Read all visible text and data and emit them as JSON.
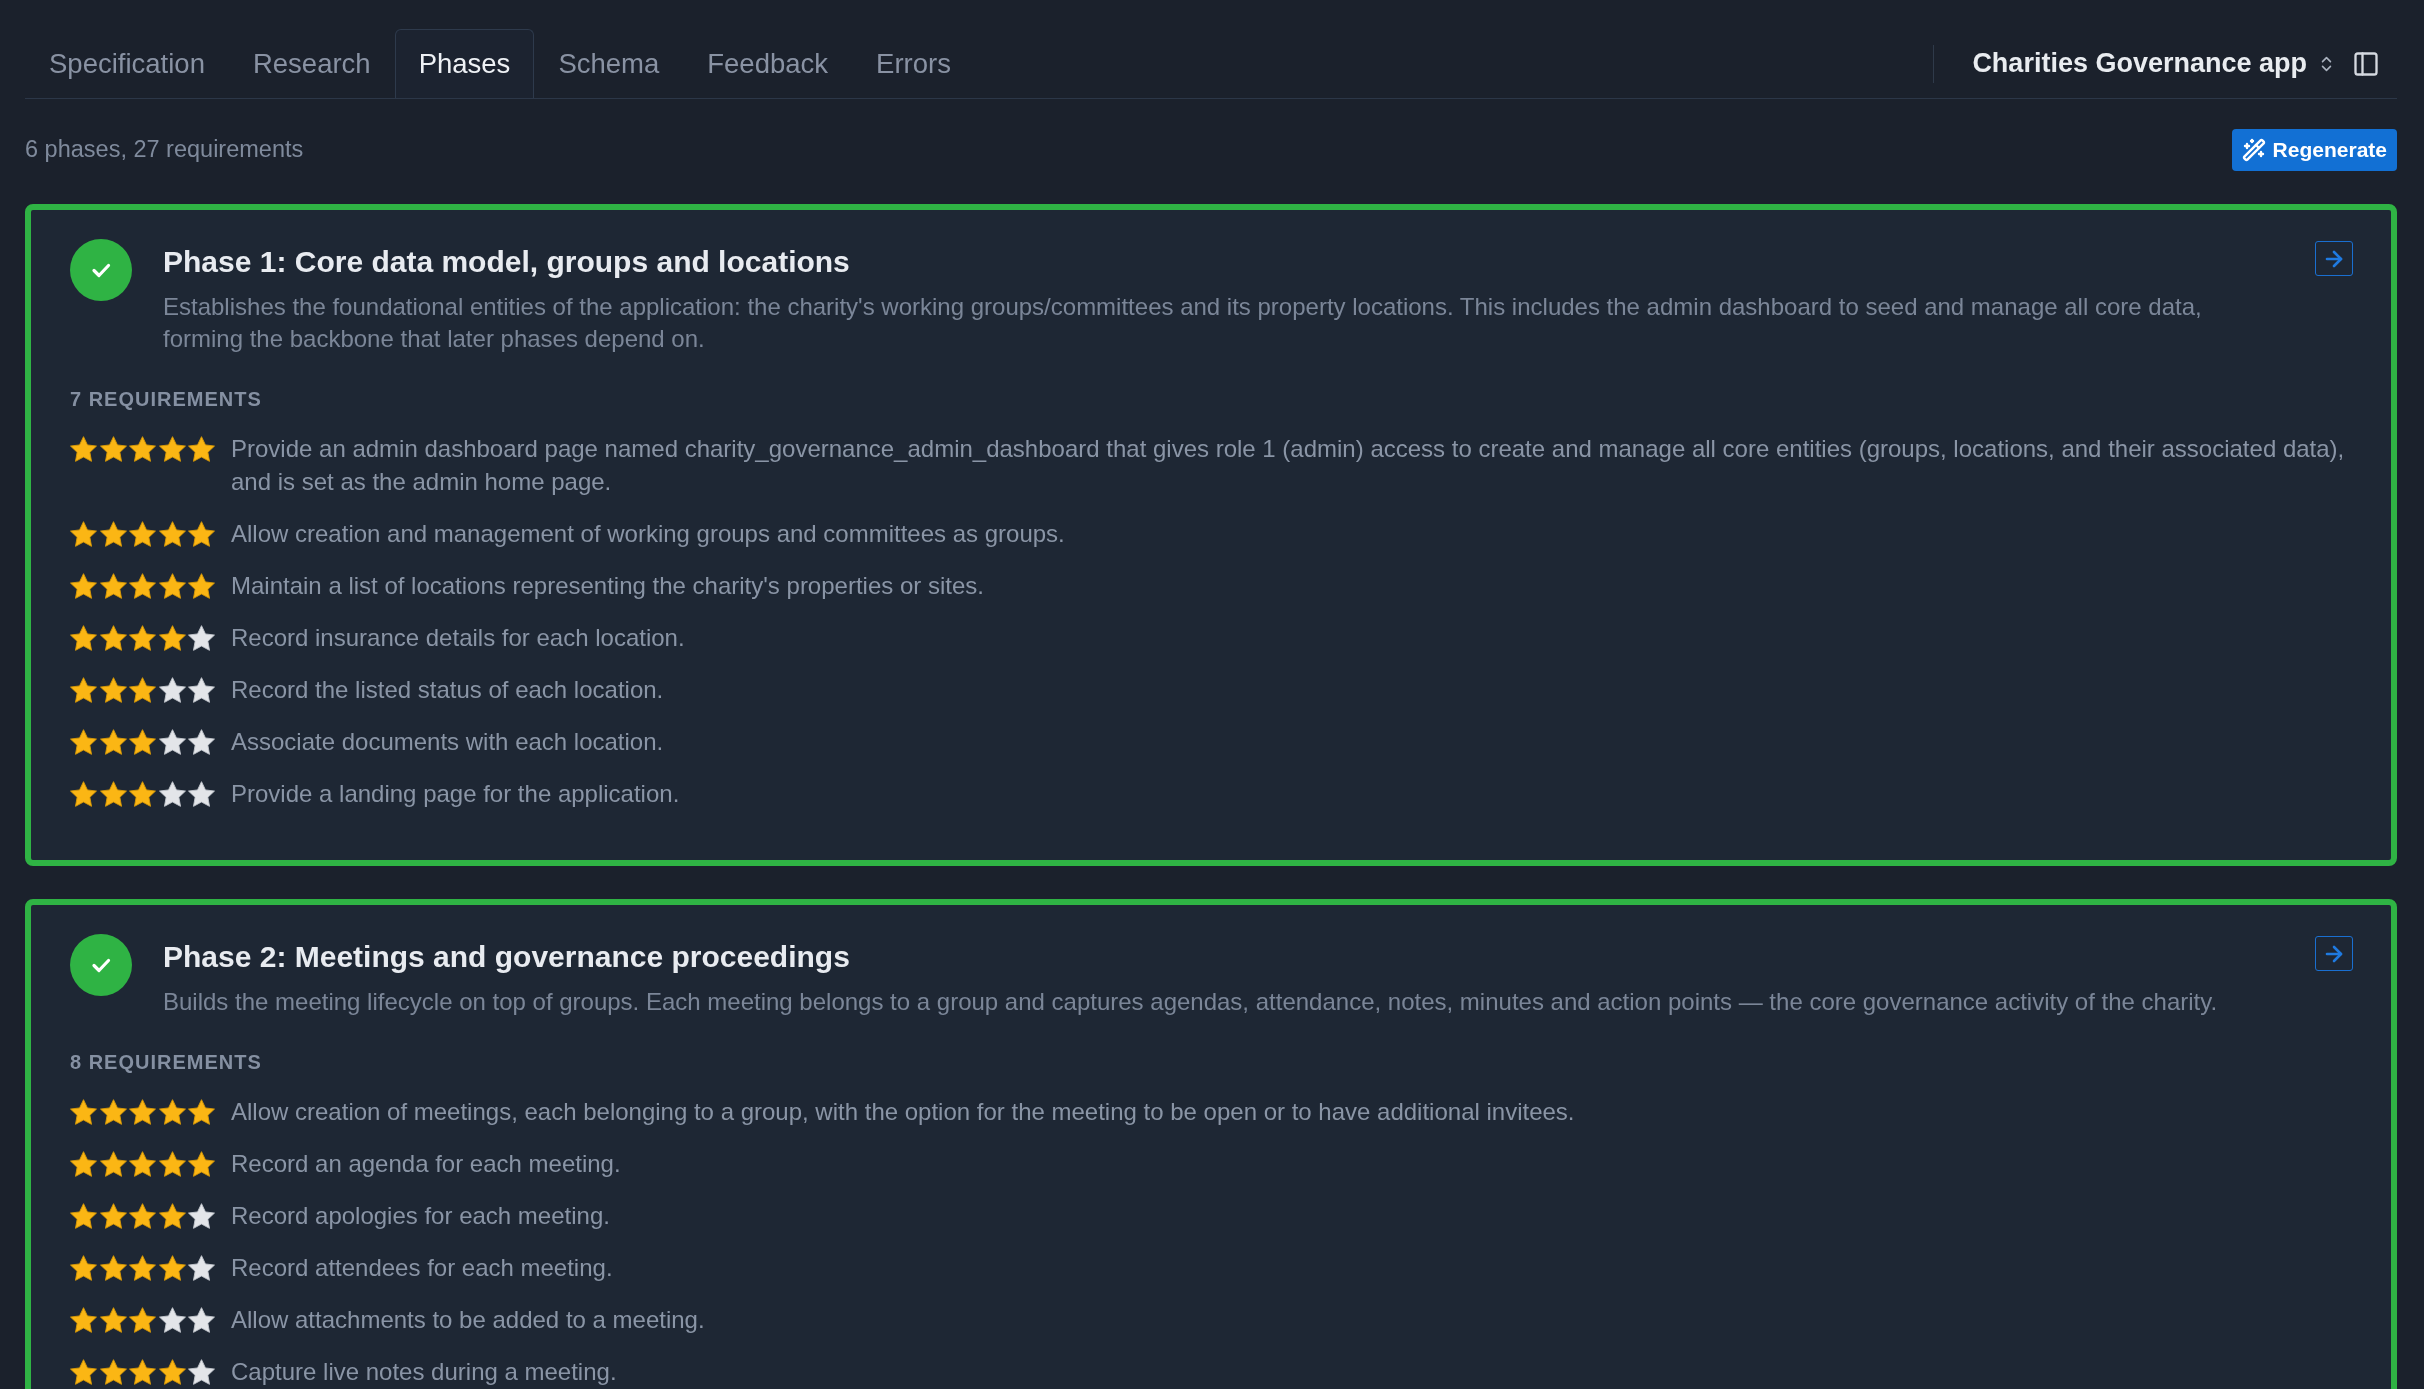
{
  "tabs": [
    {
      "label": "Specification",
      "selected": false
    },
    {
      "label": "Research",
      "selected": false
    },
    {
      "label": "Phases",
      "selected": true
    },
    {
      "label": "Schema",
      "selected": false
    },
    {
      "label": "Feedback",
      "selected": false
    },
    {
      "label": "Errors",
      "selected": false
    }
  ],
  "project_selector": {
    "label": "Charities Governance app"
  },
  "summary": "6 phases, 27 requirements",
  "regenerate_button": {
    "label": "Regenerate"
  },
  "phases": [
    {
      "title": "Phase 1: Core data model, groups and locations",
      "done": true,
      "description": "Establishes the foundational entities of the application: the charity's working groups/committees and its property locations. This includes the admin dashboard to seed and manage all core data, forming the backbone that later phases depend on.",
      "requirements_heading": "7 REQUIREMENTS",
      "requirements": [
        {
          "stars": 5,
          "text": "Provide an admin dashboard page named charity_governance_admin_dashboard that gives role 1 (admin) access to create and manage all core entities (groups, locations, and their associated data), and is set as the admin home page."
        },
        {
          "stars": 5,
          "text": "Allow creation and management of working groups and committees as groups."
        },
        {
          "stars": 5,
          "text": "Maintain a list of locations representing the charity's properties or sites."
        },
        {
          "stars": 4,
          "text": "Record insurance details for each location."
        },
        {
          "stars": 3,
          "text": "Record the listed status of each location."
        },
        {
          "stars": 3,
          "text": "Associate documents with each location."
        },
        {
          "stars": 3,
          "text": "Provide a landing page for the application."
        }
      ]
    },
    {
      "title": "Phase 2: Meetings and governance proceedings",
      "done": true,
      "description": "Builds the meeting lifecycle on top of groups. Each meeting belongs to a group and captures agendas, attendance, notes, minutes and action points — the core governance activity of the charity.",
      "requirements_heading": "8 REQUIREMENTS",
      "requirements": [
        {
          "stars": 5,
          "text": "Allow creation of meetings, each belonging to a group, with the option for the meeting to be open or to have additional invitees."
        },
        {
          "stars": 5,
          "text": "Record an agenda for each meeting."
        },
        {
          "stars": 4,
          "text": "Record apologies for each meeting."
        },
        {
          "stars": 4,
          "text": "Record attendees for each meeting."
        },
        {
          "stars": 3,
          "text": "Allow attachments to be added to a meeting."
        },
        {
          "stars": 4,
          "text": "Capture live notes during a meeting."
        }
      ]
    }
  ]
}
